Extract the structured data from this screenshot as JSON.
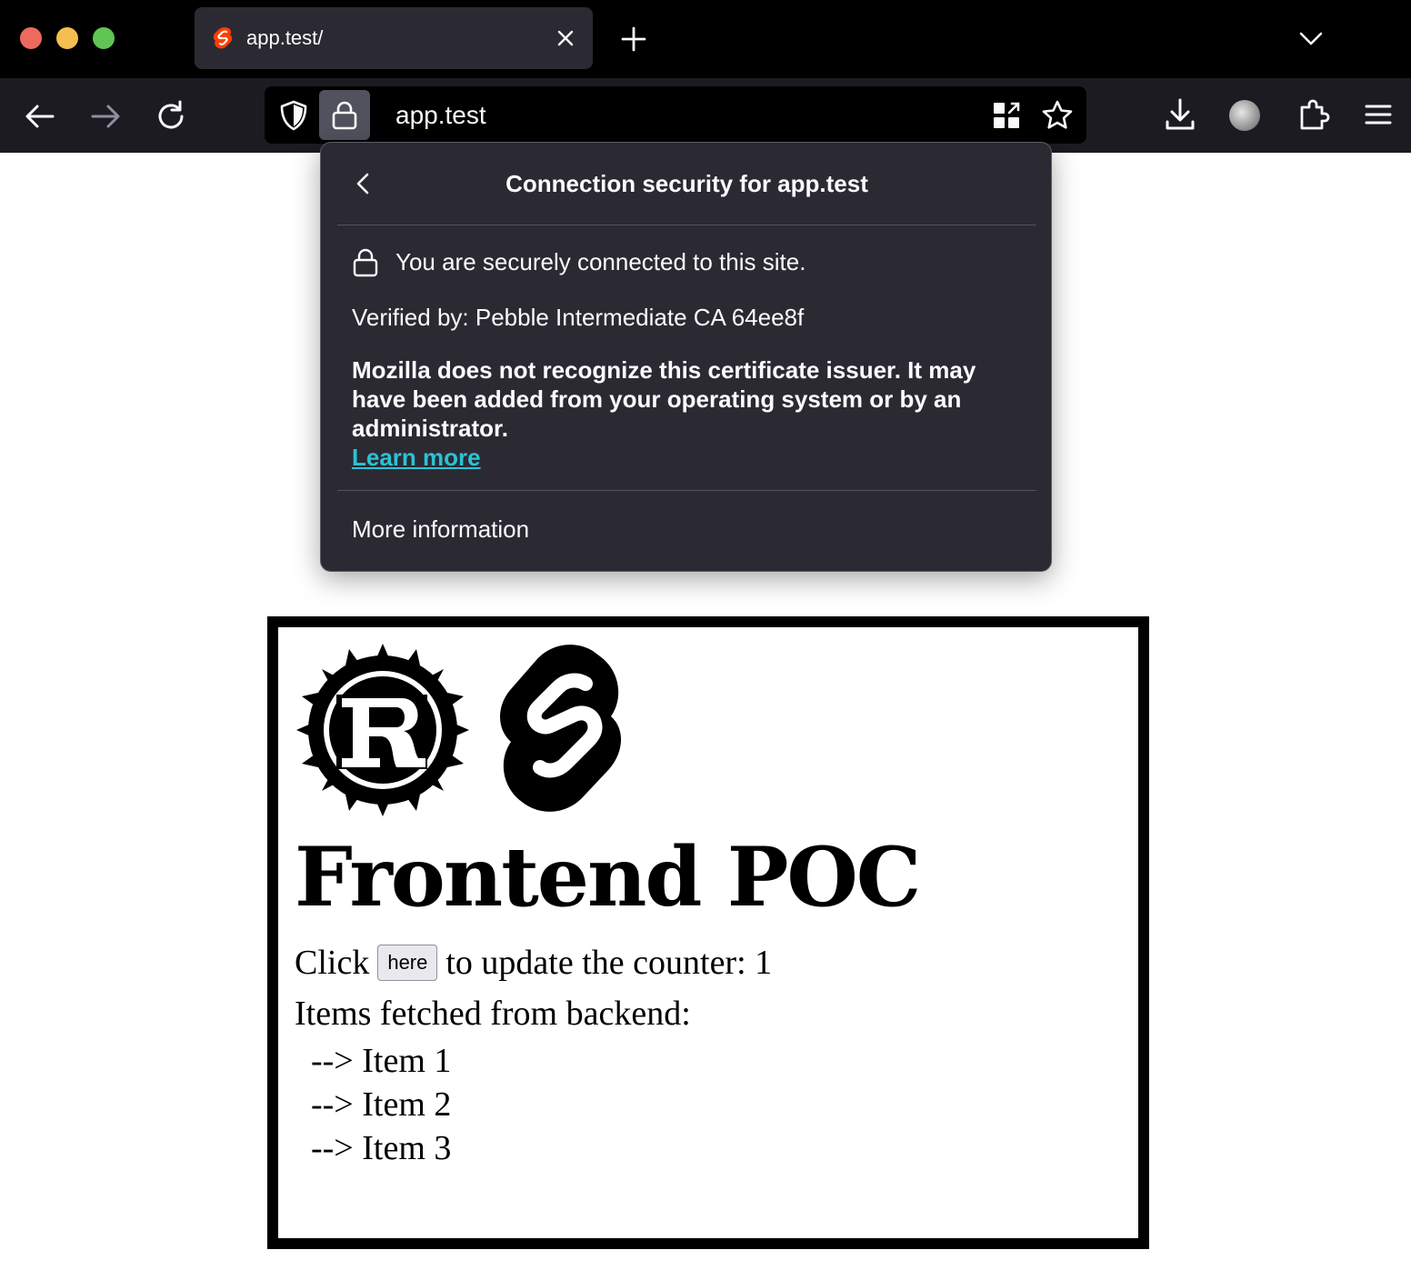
{
  "browser": {
    "tab": {
      "title": "app.test/",
      "favicon": "svelte-favicon"
    },
    "urlbar": {
      "url": "app.test"
    },
    "icons": {
      "back": "back-arrow-icon",
      "forward": "forward-arrow-icon",
      "reload": "reload-icon",
      "shield": "shield-icon",
      "lock": "lock-icon",
      "qr": "qr-code-icon",
      "bookmark": "star-icon",
      "downloads": "download-icon",
      "extensions": "puzzle-icon",
      "menu": "hamburger-menu-icon"
    },
    "colors": {
      "tabbar": "#000000",
      "toolbar": "#1c1b22",
      "tab_active": "#2b2a33",
      "popup_bg": "#2b2a33",
      "link": "#2ac3d4"
    }
  },
  "popup": {
    "title": "Connection security for app.test",
    "secure_text": "You are securely connected to this site.",
    "verified_by": "Verified by: Pebble Intermediate CA 64ee8f",
    "warning": "Mozilla does not recognize this certificate issuer. It may have been added from your operating system or by an administrator.",
    "learn_more": "Learn more",
    "more_information": "More information"
  },
  "app": {
    "title": "Frontend POC",
    "counter_prefix": "Click",
    "button_label": "here",
    "counter_suffix": "to update the counter: 1",
    "items_heading": "Items fetched from backend:",
    "items": [
      "--> Item 1",
      "--> Item 2",
      "--> Item 3"
    ]
  }
}
